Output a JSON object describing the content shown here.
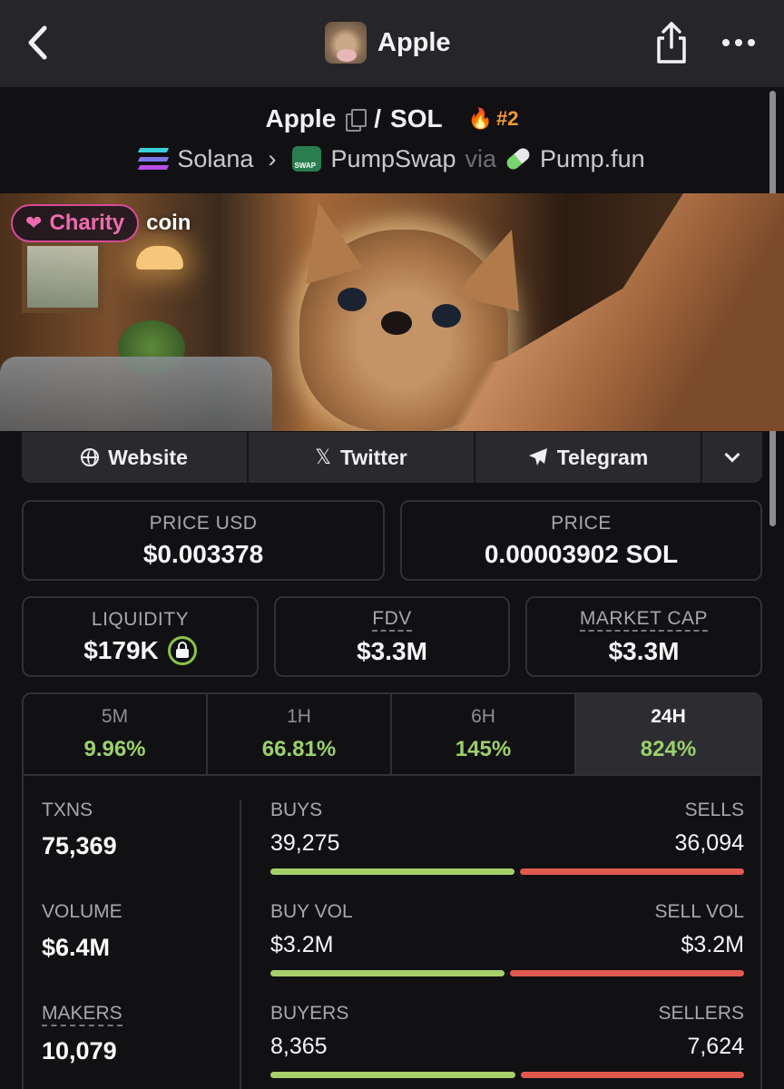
{
  "nav": {
    "title": "Apple"
  },
  "pair": {
    "base": "Apple",
    "separator": "/",
    "quote": "SOL",
    "rank": "#2",
    "chain": "Solana",
    "dex": "PumpSwap",
    "via": "via",
    "launchpad": "Pump.fun"
  },
  "banner": {
    "badge_label": "Charity",
    "badge_suffix": "coin"
  },
  "links": {
    "website": "Website",
    "twitter": "Twitter",
    "telegram": "Telegram"
  },
  "price": {
    "usd_label": "PRICE USD",
    "usd_value": "$0.003378",
    "native_label": "PRICE",
    "native_value": "0.00003902 SOL"
  },
  "metrics": {
    "liquidity_label": "LIQUIDITY",
    "liquidity_value": "$179K",
    "fdv_label": "FDV",
    "fdv_value": "$3.3M",
    "mcap_label": "MARKET CAP",
    "mcap_value": "$3.3M"
  },
  "timeframes": [
    {
      "label": "5M",
      "value": "9.96%"
    },
    {
      "label": "1H",
      "value": "66.81%"
    },
    {
      "label": "6H",
      "value": "145%"
    },
    {
      "label": "24H",
      "value": "824%",
      "selected": true
    }
  ],
  "stats": {
    "txns_label": "TXNS",
    "txns_value": "75,369",
    "volume_label": "VOLUME",
    "volume_value": "$6.4M",
    "makers_label": "MAKERS",
    "makers_value": "10,079",
    "rows": [
      {
        "left_label": "BUYS",
        "right_label": "SELLS",
        "left_value": "39,275",
        "right_value": "36,094",
        "buy_fraction": 0.521
      },
      {
        "left_label": "BUY VOL",
        "right_label": "SELL VOL",
        "left_value": "$3.2M",
        "right_value": "$3.2M",
        "buy_fraction": 0.5
      },
      {
        "left_label": "BUYERS",
        "right_label": "SELLERS",
        "left_value": "8,365",
        "right_value": "7,624",
        "buy_fraction": 0.523
      }
    ]
  },
  "colors": {
    "positive": "#9bd16a",
    "buy_bar": "#a6cf6a",
    "sell_bar": "#e0594f",
    "rank": "#f59a36",
    "charity": "#ee6cae"
  }
}
